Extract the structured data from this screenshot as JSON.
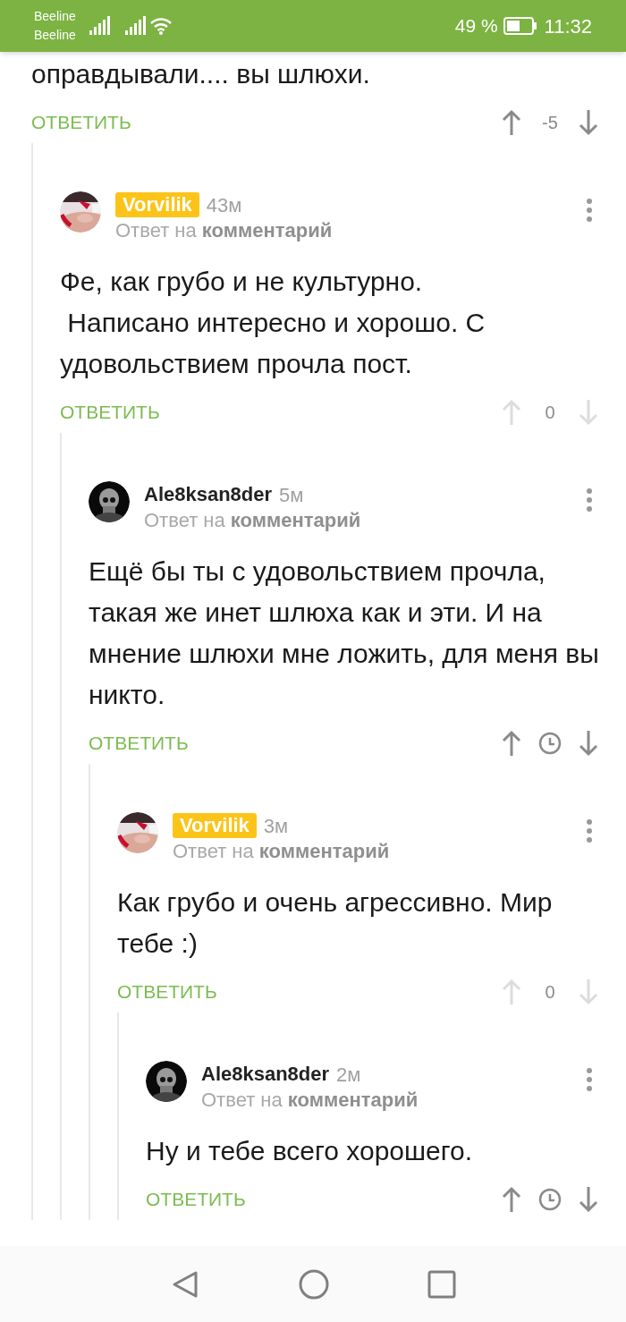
{
  "status_bar": {
    "carriers": [
      "Beeline",
      "Beeline"
    ],
    "battery": "49 %",
    "time": "11:32"
  },
  "thread": {
    "body": "оправдывали.... вы шлюхи.",
    "reply_label": "ОТВЕТИТЬ",
    "vote": {
      "kind": "score",
      "score": "-5",
      "enabled": true
    },
    "children": [
      {
        "author": "Vorvilik",
        "highlighted": true,
        "age": "43м",
        "reply_to": "Ответ на **комментарий**",
        "body": "Фе, как грубо и не культурно.\n Написано интересно и хорошо. С удовольствием прочла пост.",
        "reply_label": "ОТВЕТИТЬ",
        "vote": {
          "kind": "score",
          "score": "0",
          "enabled": false
        },
        "children": [
          {
            "author": "Ale8ksan8der",
            "highlighted": false,
            "age": "5м",
            "reply_to": "Ответ на **комментарий**",
            "body": "Ещё бы ты с удовольствием прочла, такая же инет шлюха как и эти. И на мнение шлюхи мне ложить, для меня вы никто.",
            "reply_label": "ОТВЕТИТЬ",
            "vote": {
              "kind": "timer",
              "enabled": true
            },
            "children": [
              {
                "author": "Vorvilik",
                "highlighted": true,
                "age": "3м",
                "reply_to": "Ответ на **комментарий**",
                "body": "Как грубо и очень агрессивно. Мир тебе :)",
                "reply_label": "ОТВЕТИТЬ",
                "vote": {
                  "kind": "score",
                  "score": "0",
                  "enabled": false
                },
                "children": [
                  {
                    "author": "Ale8ksan8der",
                    "highlighted": false,
                    "age": "2м",
                    "reply_to": "Ответ на **комментарий**",
                    "body": "Ну и тебе всего хорошего.",
                    "reply_label": "ОТВЕТИТЬ",
                    "vote": {
                      "kind": "timer",
                      "enabled": true
                    }
                  }
                ]
              }
            ]
          }
        ]
      }
    ]
  }
}
